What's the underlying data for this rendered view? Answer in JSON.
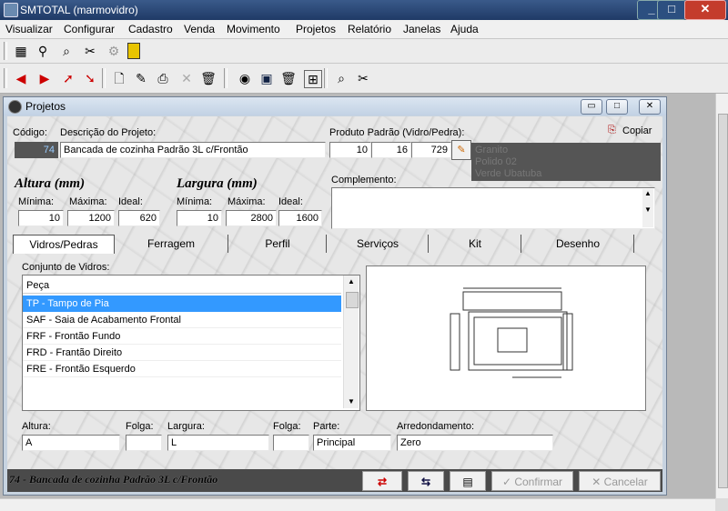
{
  "app": {
    "title": "SMTOTAL (marmovidro)",
    "controls": [
      "_",
      "□",
      "✕"
    ]
  },
  "menu": [
    "Visualizar",
    "Configurar",
    "Cadastro",
    "Venda",
    "Movimento",
    "Projetos",
    "Relatório",
    "Janelas",
    "Ajuda"
  ],
  "toolbar1_icons": [
    "calculator-icon",
    "search-key-icon",
    "find-icon",
    "tools-icon",
    "settings-icon",
    "exit-door-icon"
  ],
  "toolbar2_icons": [
    "arrow-left-icon",
    "arrow-right-icon",
    "pin-icon",
    "arrow-down-right-icon",
    "new-doc-icon",
    "edit-doc-icon",
    "print-icon",
    "delete-x-icon",
    "trash-icon",
    "camera-icon",
    "save-icon",
    "trash-2-icon",
    "grid-icon",
    "preview-icon",
    "tools-2-icon"
  ],
  "window": {
    "title": "Projetos",
    "controls": [
      "▭",
      "□",
      "✕"
    ]
  },
  "form": {
    "codigo_label": "Código:",
    "codigo_value": "74",
    "descricao_label": "Descrição do Projeto:",
    "descricao_value": "Bancada de cozinha Padrão 3L c/Frontão",
    "produto_label": "Produto Padrão (Vidro/Pedra):",
    "produto_values": [
      "10",
      "16",
      "729"
    ],
    "copiar_label": "Copiar",
    "produto_desc": [
      "Granito",
      "Polido 02",
      "Verde Ubatuba"
    ],
    "altura_title": "Altura (mm)",
    "largura_title": "Largura (mm)",
    "minima_label": "Mínima:",
    "maxima_label": "Máxima:",
    "ideal_label": "Ideal:",
    "altura": {
      "min": "10",
      "max": "1200",
      "ideal": "620"
    },
    "largura": {
      "min": "10",
      "max": "2800",
      "ideal": "1600"
    },
    "complemento_label": "Complemento:",
    "complemento_value": ""
  },
  "tabs": [
    "Vidros/Pedras",
    "Ferragem",
    "Perfil",
    "Serviços",
    "Kit",
    "Desenho"
  ],
  "active_tab": "Vidros/Pedras",
  "conjunto_label": "Conjunto de Vidros:",
  "list": {
    "header": "Peça",
    "rows": [
      "TP - Tampo de Pia",
      "SAF - Saia de Acabamento Frontal",
      "FRF - Frontão Fundo",
      "FRD - Frantão Direito",
      "FRE - Frontão Esquerdo"
    ],
    "selected_index": 0
  },
  "fields": {
    "altura_label": "Altura:",
    "altura_value": "A",
    "folga1_label": "Folga:",
    "folga1_value": "",
    "largura_label": "Largura:",
    "largura_value": "L",
    "folga2_label": "Folga:",
    "folga2_value": "",
    "parte_label": "Parte:",
    "parte_value": "Principal",
    "arred_label": "Arredondamento:",
    "arred_value": "Zero"
  },
  "status_text": "74 - Bancada de cozinha Padrão 3L c/Frontão",
  "buttons": {
    "confirmar": "Confirmar",
    "cancelar": "Cancelar"
  },
  "colors": {
    "selected_row": "#3399ff",
    "titlebar": "#2a4a7a",
    "status_bar": "#4a4a4a",
    "arrow_red": "#cc0000"
  }
}
